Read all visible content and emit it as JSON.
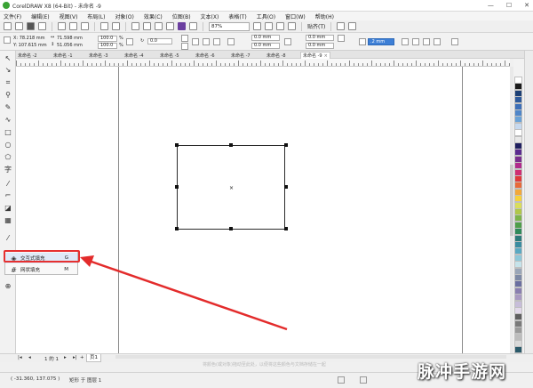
{
  "window": {
    "title": "CorelDRAW X8 (64-Bit) - 未命名 -9",
    "min": "—",
    "max": "☐",
    "close": "✕"
  },
  "menu": [
    "文件(F)",
    "编辑(E)",
    "视图(V)",
    "布局(L)",
    "对象(O)",
    "效果(C)",
    "位图(B)",
    "文本(X)",
    "表格(T)",
    "工具(O)",
    "窗口(W)",
    "帮助(H)"
  ],
  "toolbar": {
    "zoom": "87%",
    "snap": "贴齐(T)"
  },
  "propbar": {
    "x": "X: 78.218 mm",
    "y": "Y: 107.615 mm",
    "w": "71.598 mm",
    "h": "51.056 mm",
    "sx": "100.0",
    "sy": "100.0",
    "pct": "%",
    "angle": "0.0",
    "c1": "0.0 mm",
    "c2": "0.0 mm",
    "c3": "0.0 mm",
    "c4": "0.0 mm",
    "outline": ".2 mm"
  },
  "tabs": [
    "未命名 -2",
    "未命名 -1",
    "未命名 -3",
    "未命名 -4",
    "未命名 -5",
    "未命名 -6",
    "未命名 -7",
    "未命名 -8",
    "未命名 -9"
  ],
  "flyout": {
    "items": [
      {
        "label": "交互式填充",
        "shortcut": "G"
      },
      {
        "label": "网状填充",
        "shortcut": "M"
      }
    ]
  },
  "pagebar": {
    "page_info": "1 的 1",
    "page_tab": "页1"
  },
  "hint": "将颜色(或对象)拖动至此处，以便将这些颜色与文档存储在一起",
  "status": {
    "coords": "( -31.360, 137.075 )",
    "object": "矩形 于 图层 1"
  },
  "watermark": "脉冲手游网",
  "palette_colors": [
    "#ffffff",
    "#1a1a1a",
    "#1c3f74",
    "#2e5a9c",
    "#3d6fb8",
    "#4f86c9",
    "#6aa2d8",
    "#c7d9ef",
    "#ffffff",
    "#e8e8e8",
    "#202060",
    "#5b2b8f",
    "#7a2e8e",
    "#b12a8c",
    "#cf2f72",
    "#e03a3a",
    "#e86a3a",
    "#f2a83a",
    "#f7d13a",
    "#d9dd5a",
    "#b0c74a",
    "#7db44a",
    "#4f9e4a",
    "#2f8a5a",
    "#2c7a7a",
    "#3a8ca0",
    "#5aa9c2",
    "#8ec8d9",
    "#c6e3ea",
    "#9aa6b8",
    "#7e8aa6",
    "#6b6fa0",
    "#8a7fb0",
    "#a99ac2",
    "#c7bdd9",
    "#e2d9ea",
    "#5f5f5f",
    "#7a7a7a",
    "#9a9a9a",
    "#bcbcbc",
    "#d9d9d9",
    "#2b5a6a",
    "#3e7a8a"
  ]
}
